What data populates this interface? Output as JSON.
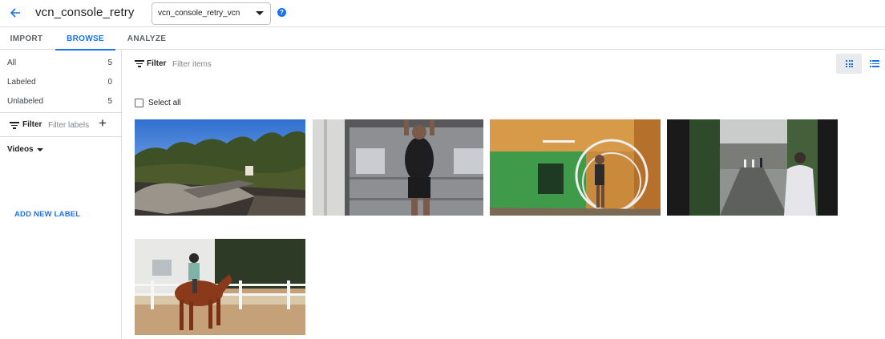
{
  "header": {
    "title": "vcn_console_retry",
    "dataset_select_value": "vcn_console_retry_vcn",
    "help_glyph": "?",
    "accent_color": "#1a73e8"
  },
  "tabs": [
    {
      "label": "IMPORT",
      "active": false
    },
    {
      "label": "BROWSE",
      "active": true
    },
    {
      "label": "ANALYZE",
      "active": false
    }
  ],
  "sidebar": {
    "counts": [
      {
        "label": "All",
        "value": "5"
      },
      {
        "label": "Labeled",
        "value": "0"
      },
      {
        "label": "Unlabeled",
        "value": "5"
      }
    ],
    "filter_label": "Filter",
    "filter_placeholder": "Filter labels",
    "add_glyph": "+",
    "videos_label": "Videos",
    "add_new_label": "ADD NEW LABEL"
  },
  "main": {
    "filter_label": "Filter",
    "filter_placeholder": "Filter items",
    "select_all_label": "Select all",
    "view_mode": "grid",
    "videos": [
      {
        "description": "outdoor scene with trees and driftwood"
      },
      {
        "description": "person doing pull-up in front of garage door"
      },
      {
        "description": "gymnast in wheel by orange and green wall"
      },
      {
        "description": "person in white hoodie walking down alley"
      },
      {
        "description": "rider on chestnut horse in arena"
      }
    ]
  }
}
